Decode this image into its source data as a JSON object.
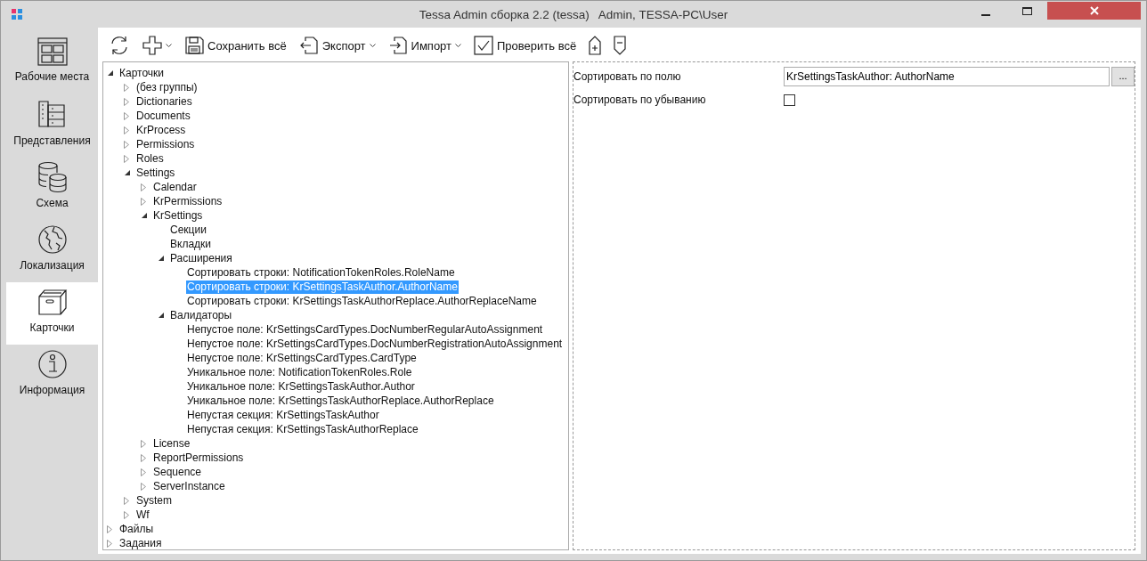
{
  "window": {
    "title": "Tessa Admin сборка 2.2 (tessa)",
    "user": "Admin, TESSA-PC\\User"
  },
  "sidebar": {
    "items": [
      {
        "kind": "workplaces",
        "label": "Рабочие места",
        "selected": false
      },
      {
        "kind": "views",
        "label": "Представления",
        "selected": false
      },
      {
        "kind": "schema",
        "label": "Схема",
        "selected": false
      },
      {
        "kind": "localization",
        "label": "Локализация",
        "selected": false
      },
      {
        "kind": "cards",
        "label": "Карточки",
        "selected": true
      },
      {
        "kind": "info",
        "label": "Информация",
        "selected": false
      }
    ]
  },
  "toolbar": {
    "buttons": [
      {
        "kind": "refresh",
        "dropdown": false
      },
      {
        "kind": "add",
        "dropdown": true
      },
      {
        "kind": "save",
        "label": "Сохранить всё",
        "dropdown": false
      },
      {
        "kind": "export",
        "label": "Экспорт",
        "dropdown": true
      },
      {
        "kind": "import",
        "label": "Импорт",
        "dropdown": true
      },
      {
        "kind": "check",
        "label": "Проверить всё",
        "dropdown": false
      },
      {
        "kind": "tag-plus",
        "dropdown": false
      },
      {
        "kind": "tag-minus",
        "dropdown": false
      }
    ]
  },
  "tree": {
    "nodes": [
      {
        "label": "Карточки",
        "expanded": true,
        "selected": false,
        "children": [
          {
            "label": "(без группы)",
            "expanded": false,
            "selected": false
          },
          {
            "label": "Dictionaries",
            "expanded": false,
            "selected": false
          },
          {
            "label": "Documents",
            "expanded": false,
            "selected": false
          },
          {
            "label": "KrProcess",
            "expanded": false,
            "selected": false
          },
          {
            "label": "Permissions",
            "expanded": false,
            "selected": false
          },
          {
            "label": "Roles",
            "expanded": false,
            "selected": false
          },
          {
            "label": "Settings",
            "expanded": true,
            "selected": false,
            "children": [
              {
                "label": "Calendar",
                "expanded": false,
                "selected": false
              },
              {
                "label": "KrPermissions",
                "expanded": false,
                "selected": false
              },
              {
                "label": "KrSettings",
                "expanded": true,
                "selected": false,
                "children": [
                  {
                    "label": "Секции",
                    "selected": false
                  },
                  {
                    "label": "Вкладки",
                    "selected": false
                  },
                  {
                    "label": "Расширения",
                    "expanded": true,
                    "selected": false,
                    "children": [
                      {
                        "label": "Сортировать строки: NotificationTokenRoles.RoleName",
                        "selected": false
                      },
                      {
                        "label": "Сортировать строки: KrSettingsTaskAuthor.AuthorName",
                        "selected": true
                      },
                      {
                        "label": "Сортировать строки: KrSettingsTaskAuthorReplace.AuthorReplaceName",
                        "selected": false
                      }
                    ]
                  },
                  {
                    "label": "Валидаторы",
                    "expanded": true,
                    "selected": false,
                    "children": [
                      {
                        "label": "Непустое поле: KrSettingsCardTypes.DocNumberRegularAutoAssignment",
                        "selected": false
                      },
                      {
                        "label": "Непустое поле: KrSettingsCardTypes.DocNumberRegistrationAutoAssignment",
                        "selected": false
                      },
                      {
                        "label": "Непустое поле: KrSettingsCardTypes.CardType",
                        "selected": false
                      },
                      {
                        "label": "Уникальное поле: NotificationTokenRoles.Role",
                        "selected": false
                      },
                      {
                        "label": "Уникальное поле: KrSettingsTaskAuthor.Author",
                        "selected": false
                      },
                      {
                        "label": "Уникальное поле: KrSettingsTaskAuthorReplace.AuthorReplace",
                        "selected": false
                      },
                      {
                        "label": "Непустая секция: KrSettingsTaskAuthor",
                        "selected": false
                      },
                      {
                        "label": "Непустая секция: KrSettingsTaskAuthorReplace",
                        "selected": false
                      }
                    ]
                  }
                ]
              },
              {
                "label": "License",
                "expanded": false,
                "selected": false
              },
              {
                "label": "ReportPermissions",
                "expanded": false,
                "selected": false
              },
              {
                "label": "Sequence",
                "expanded": false,
                "selected": false
              },
              {
                "label": "ServerInstance",
                "expanded": false,
                "selected": false
              }
            ]
          },
          {
            "label": "System",
            "expanded": false,
            "selected": false
          },
          {
            "label": "Wf",
            "expanded": false,
            "selected": false
          }
        ]
      },
      {
        "label": "Файлы",
        "expanded": false,
        "selected": false
      },
      {
        "label": "Задания",
        "expanded": false,
        "selected": false
      }
    ]
  },
  "properties": {
    "fields": [
      {
        "kind": "lookup",
        "label": "Сортировать по полю",
        "value": "KrSettingsTaskAuthor: AuthorName",
        "button": "..."
      },
      {
        "kind": "checkbox",
        "label": "Сортировать по убыванию",
        "checked": false
      }
    ]
  }
}
